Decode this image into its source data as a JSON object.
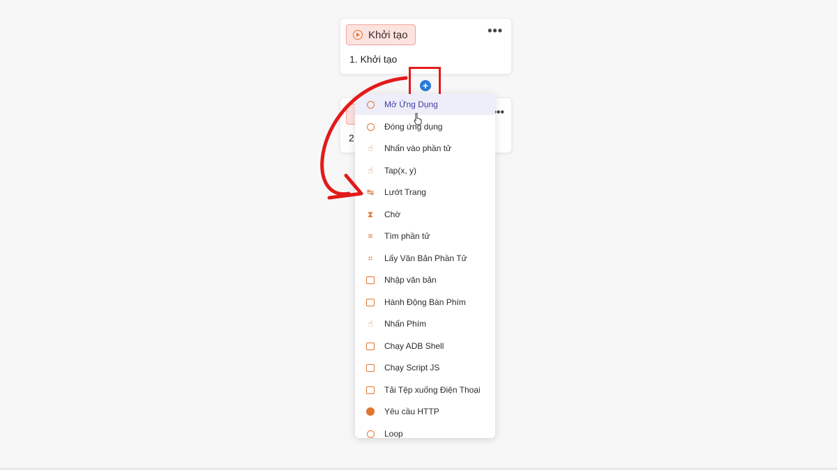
{
  "cards": {
    "start": {
      "badge_label": "Khởi tạo",
      "title": "1. Khởi tạo",
      "more": "•••"
    },
    "second": {
      "number_prefix": "2",
      "more": "•••"
    }
  },
  "add_button": {
    "symbol": "+"
  },
  "menu": {
    "items": [
      {
        "label": "Mở Ứng Dụng",
        "icon": "open-app-icon",
        "highlighted": true
      },
      {
        "label": "Đóng ứng dụng",
        "icon": "close-app-icon"
      },
      {
        "label": "Nhấn vào phần tử",
        "icon": "tap-element-icon"
      },
      {
        "label": "Tap(x, y)",
        "icon": "tap-xy-icon"
      },
      {
        "label": "Lướt Trang",
        "icon": "swipe-icon"
      },
      {
        "label": "Chờ",
        "icon": "hourglass-icon"
      },
      {
        "label": "Tìm phần tử",
        "icon": "find-element-icon"
      },
      {
        "label": "Lấy Văn Bản Phần Tử",
        "icon": "get-text-icon"
      },
      {
        "label": "Nhập văn bản",
        "icon": "input-text-icon"
      },
      {
        "label": "Hành Động Bàn Phím",
        "icon": "keyboard-icon"
      },
      {
        "label": "Nhấn Phím",
        "icon": "press-key-icon"
      },
      {
        "label": "Chạy ADB Shell",
        "icon": "terminal-icon"
      },
      {
        "label": "Chạy Script JS",
        "icon": "script-file-icon"
      },
      {
        "label": "Tải Tệp xuống Điện Thoại",
        "icon": "folder-download-icon"
      },
      {
        "label": "Yêu cầu HTTP",
        "icon": "globe-icon"
      },
      {
        "label": "Loop",
        "icon": "loop-icon"
      }
    ]
  },
  "colors": {
    "accent": "#e0752e",
    "highlight_box": "#e31a1a",
    "add_button": "#2b7bd8",
    "menu_highlight": "#eeeefa"
  }
}
